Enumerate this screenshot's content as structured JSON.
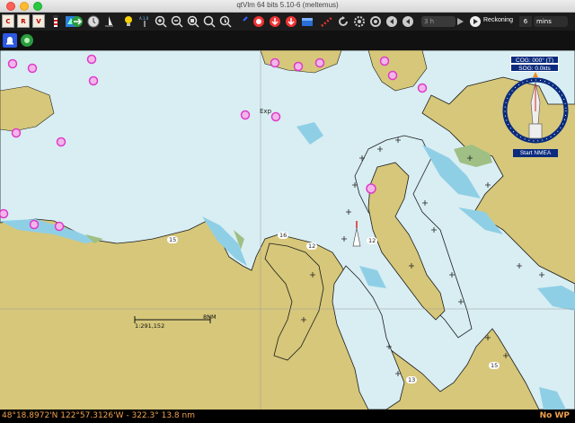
{
  "window": {
    "title": "qtVlm 64 bits 5.10-6 (meltemus)"
  },
  "toolbar": {
    "charts": [
      "C",
      "R",
      "V"
    ],
    "time_step": "3 h",
    "reckoning_label": "Reckoning",
    "reckoning_value": "6",
    "reckoning_unit": "mins"
  },
  "dashboard": {
    "cog": "COG: 000° (T)",
    "sog": "SOG: 0.0kts",
    "start_nmea": "Start NMEA"
  },
  "map": {
    "scale_label": "1:291,152",
    "scale_distance": "8NM",
    "place_label": "Exp",
    "current_labels": [
      "15",
      "16",
      "12",
      "15",
      "12",
      "13"
    ],
    "colors": {
      "land": "#d6c77a",
      "shallow": "#b9e2ef",
      "water": "#d8eef3",
      "deep": "#c4e6f0",
      "marker": "#e03ac9"
    }
  },
  "status": {
    "position": "48°18.8972'N 122°57.3126'W - 322.3° 13.8 nm",
    "waypoint": "No WP"
  }
}
